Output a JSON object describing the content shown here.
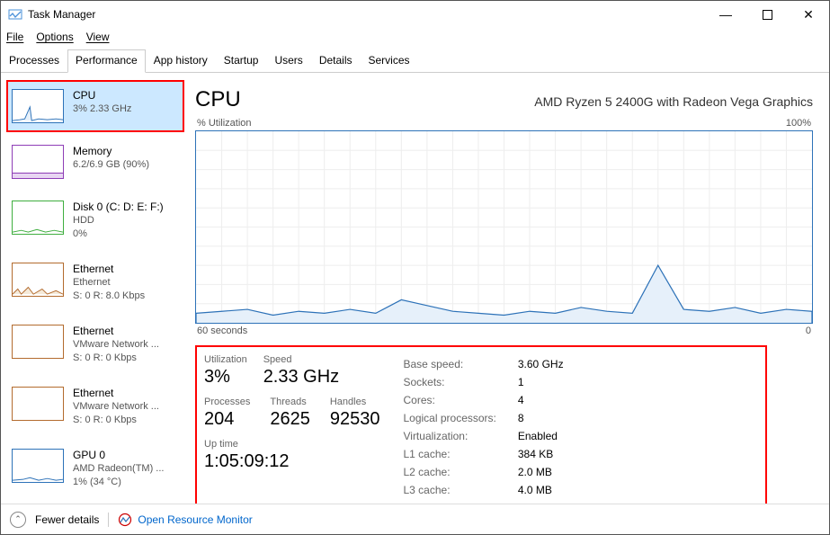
{
  "titlebar": {
    "title": "Task Manager"
  },
  "menu": {
    "file": "File",
    "options": "Options",
    "view": "View"
  },
  "tabs": [
    "Processes",
    "Performance",
    "App history",
    "Startup",
    "Users",
    "Details",
    "Services"
  ],
  "active_tab": 1,
  "sidebar": {
    "items": [
      {
        "title": "CPU",
        "sub": "3%  2.33 GHz",
        "color": "#2d72b8"
      },
      {
        "title": "Memory",
        "sub": "6.2/6.9 GB (90%)",
        "color": "#8e3db6"
      },
      {
        "title": "Disk 0 (C: D: E: F:)",
        "sub": "HDD",
        "sub2": "0%",
        "color": "#3fae3f"
      },
      {
        "title": "Ethernet",
        "sub": "Ethernet",
        "sub2": "S: 0  R: 8.0 Kbps",
        "color": "#b36b2e"
      },
      {
        "title": "Ethernet",
        "sub": "VMware Network ...",
        "sub2": "S: 0  R: 0 Kbps",
        "color": "#b36b2e"
      },
      {
        "title": "Ethernet",
        "sub": "VMware Network ...",
        "sub2": "S: 0  R: 0 Kbps",
        "color": "#b36b2e"
      },
      {
        "title": "GPU 0",
        "sub": "AMD Radeon(TM) ...",
        "sub2": "1% (34 °C)",
        "color": "#2d72b8"
      }
    ]
  },
  "main": {
    "big_title": "CPU",
    "cpu_name": "AMD Ryzen 5 2400G with Radeon Vega Graphics",
    "chart_tl": "% Utilization",
    "chart_tr": "100%",
    "chart_bl": "60 seconds",
    "chart_br": "0",
    "stats": {
      "utilization_label": "Utilization",
      "utilization": "3%",
      "speed_label": "Speed",
      "speed": "2.33 GHz",
      "processes_label": "Processes",
      "processes": "204",
      "threads_label": "Threads",
      "threads": "2625",
      "handles_label": "Handles",
      "handles": "92530",
      "uptime_label": "Up time",
      "uptime": "1:05:09:12"
    },
    "specs": [
      [
        "Base speed:",
        "3.60 GHz"
      ],
      [
        "Sockets:",
        "1"
      ],
      [
        "Cores:",
        "4"
      ],
      [
        "Logical processors:",
        "8"
      ],
      [
        "Virtualization:",
        "Enabled"
      ],
      [
        "L1 cache:",
        "384 KB"
      ],
      [
        "L2 cache:",
        "2.0 MB"
      ],
      [
        "L3 cache:",
        "4.0 MB"
      ]
    ]
  },
  "footer": {
    "fewer": "Fewer details",
    "orm": "Open Resource Monitor"
  },
  "chart_data": {
    "type": "line",
    "title": "% Utilization",
    "xlabel": "60 seconds",
    "ylabel": "% Utilization",
    "xlim": [
      60,
      0
    ],
    "ylim": [
      0,
      100
    ],
    "x": [
      60,
      57.5,
      55,
      52.5,
      50,
      47.5,
      45,
      42.5,
      40,
      37.5,
      35,
      32.5,
      30,
      27.5,
      25,
      22.5,
      20,
      17.5,
      15,
      12.5,
      10,
      7.5,
      5,
      2.5,
      0
    ],
    "values": [
      5,
      6,
      7,
      4,
      6,
      5,
      7,
      5,
      12,
      9,
      6,
      5,
      4,
      6,
      5,
      8,
      6,
      5,
      30,
      7,
      6,
      8,
      5,
      7,
      6
    ]
  }
}
